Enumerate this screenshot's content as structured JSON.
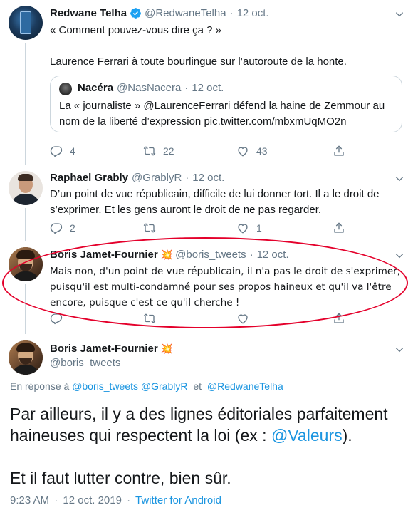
{
  "tweets": [
    {
      "name": "Redwane Telha",
      "handle": "@RedwaneTelha",
      "separator": "·",
      "date": "12 oct.",
      "text_line1": "« Comment pouvez-vous dire ça ? »",
      "text_line2": "Laurence Ferrari à toute bourlingue sur l’autoroute de la honte.",
      "quote": {
        "name": "Nacéra",
        "handle": "@NasNacera",
        "date": "12 oct.",
        "text_line1": "La « journaliste » @LaurenceFerrari défend la haine de Zemmour au",
        "text_line2": "nom de la liberté d’expression pic.twitter.com/mbxmUqMO2n"
      },
      "replies": "4",
      "retweets": "22",
      "likes": "43"
    },
    {
      "name": "Raphael Grably",
      "handle": "@GrablyR",
      "separator": "·",
      "date": "12 oct.",
      "text_line1": "D’un point de vue républicain, difficile de lui donner tort. Il a le droit de",
      "text_line2": "s’exprimer. Et les gens auront le droit de ne pas regarder.",
      "replies": "2",
      "retweets": "",
      "likes": "1"
    },
    {
      "name": "Boris Jamet-Fournier",
      "emoji": "💥",
      "handle": "@boris_tweets",
      "separator": "·",
      "date": "12 oct.",
      "text_line1": "Mais non, d'un point de vue républicain, il n'a pas le droit de s'exprimer,",
      "text_line2": "puisqu'il est multi-condamné pour ses propos haineux et qu'il va l'être",
      "text_line3": "encore, puisque c'est ce qu'il cherche !"
    }
  ],
  "main_tweet": {
    "name": "Boris Jamet-Fournier",
    "emoji": "💥",
    "handle": "@boris_tweets",
    "reply_prefix": "En réponse à",
    "reply_user1": "@boris_tweets",
    "reply_user2": "@GrablyR",
    "reply_and": "et",
    "reply_user3": "@RedwaneTelha",
    "text_line1": "Par ailleurs, il y a des lignes éditoriales parfaitement",
    "text_line2_prefix": "haineuses qui respectent la loi (ex : ",
    "text_line2_link": "@Valeurs",
    "text_line2_suffix": ").",
    "text_line3": "Et il faut lutter contre, bien sûr.",
    "time": "9:23 AM",
    "separator": "·",
    "date": "12 oct. 2019",
    "separator2": "·",
    "source": "Twitter for Android"
  },
  "colors": {
    "link": "#1b95e0",
    "secondary_text": "#657786",
    "annotation_ellipse": "#e4002b",
    "verified_badge": "#1da1f2"
  }
}
